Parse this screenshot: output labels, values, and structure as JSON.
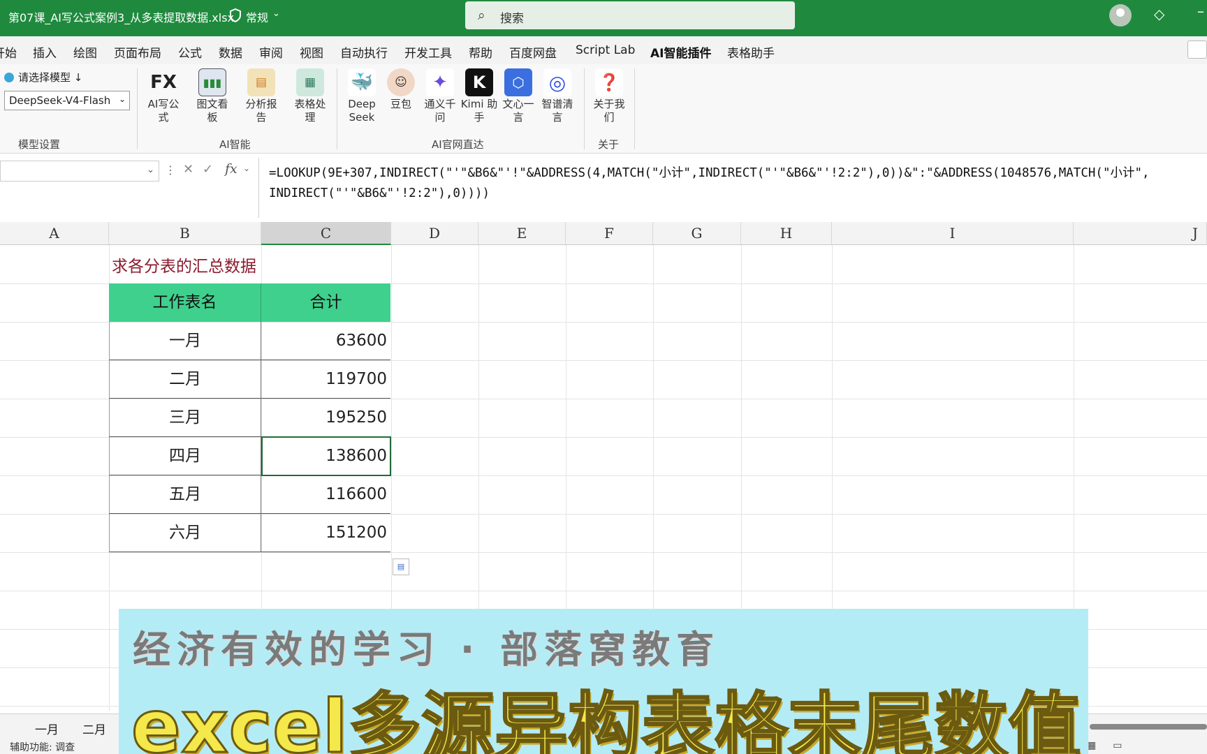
{
  "titlebar": {
    "filename": "第07课_AI写公式案例3_从多表提取数据.xlsx",
    "sensitivity": "常规",
    "search_placeholder": "搜索"
  },
  "ribbon_tabs": [
    "开始",
    "插入",
    "绘图",
    "页面布局",
    "公式",
    "数据",
    "审阅",
    "视图",
    "自动执行",
    "开发工具",
    "帮助",
    "百度网盘",
    "Script Lab",
    "AI智能插件",
    "表格助手"
  ],
  "active_tab": "AI智能插件",
  "ribbon": {
    "model_label": "请选择模型 ↓",
    "model_value": "DeepSeek-V4-Flash",
    "groups": {
      "model": "模型设置",
      "ai": "AI智能",
      "official": "AI官网直达",
      "about": "关于"
    },
    "buttons": {
      "ai_formula": "AI写公式",
      "chart_board": "图文看板",
      "analysis": "分析报告",
      "table_proc": "表格处理",
      "deepseek": "Deep Seek",
      "doubao": "豆包",
      "tongyi": "通义千问",
      "kimi": "Kimi 助手",
      "wenxin": "文心一言",
      "zhipu": "智谱清言",
      "about_us": "关于我们"
    }
  },
  "formula_bar": {
    "name_box": "",
    "formula": "=LOOKUP(9E+307,INDIRECT(\"'\"&B6&\"'!\"&ADDRESS(4,MATCH(\"小计\",INDIRECT(\"'\"&B6&\"'!2:2\"),0))&\":\"&ADDRESS(1048576,MATCH(\"小计\",\nINDIRECT(\"'\"&B6&\"'!2:2\"),0))))"
  },
  "columns": [
    "A",
    "B",
    "C",
    "D",
    "E",
    "F",
    "G",
    "H",
    "I",
    "J"
  ],
  "selected_column": "C",
  "sheet": {
    "title": "求各分表的汇总数据",
    "header": {
      "name": "工作表名",
      "total": "合计"
    },
    "rows": [
      {
        "name": "一月",
        "total": "63600"
      },
      {
        "name": "二月",
        "total": "119700"
      },
      {
        "name": "三月",
        "total": "195250"
      },
      {
        "name": "四月",
        "total": "138600"
      },
      {
        "name": "五月",
        "total": "116600"
      },
      {
        "name": "六月",
        "total": "151200"
      }
    ]
  },
  "sheet_tabs": [
    "一月",
    "二月"
  ],
  "status": {
    "accessibility": "辅助功能: 调查"
  },
  "banner": {
    "subtitle": "经济有效的学习 · 部落窝教育",
    "title": "excel多源异构表格末尾数值自动化提取"
  },
  "colors": {
    "titlebar": "#1f8a3e",
    "header_fill": "#3fd08e",
    "title_text": "#8b1a2e"
  }
}
